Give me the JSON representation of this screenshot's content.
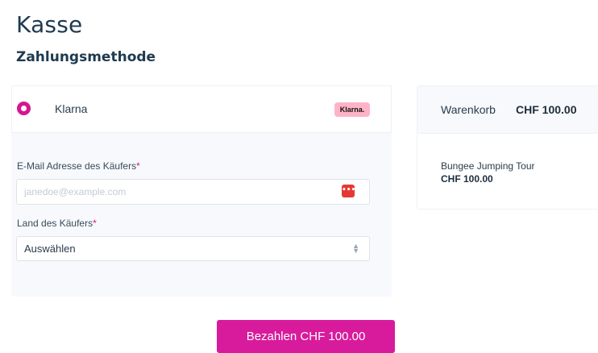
{
  "page": {
    "title": "Kasse",
    "section_title": "Zahlungsmethode"
  },
  "payment": {
    "method_label": "Klarna",
    "method_logo_text": "Klarna.",
    "method_selected": true,
    "email_label": "E-Mail Adresse des Käufers",
    "email_placeholder": "janedoe@example.com",
    "email_value": "",
    "email_icon": "password-manager-icon",
    "country_label": "Land des Käufers",
    "country_selected": "Auswählen",
    "required_marker": "*"
  },
  "pay_button_label": "Bezahlen CHF 100.00",
  "cart": {
    "title": "Warenkorb",
    "total": "CHF 100.00",
    "items": [
      {
        "name": "Bungee Jumping Tour",
        "price": "CHF 100.00"
      }
    ]
  },
  "colors": {
    "accent": "#d81b9c",
    "klarna_badge": "#ffb3c7",
    "heading": "#1e3a4f"
  }
}
